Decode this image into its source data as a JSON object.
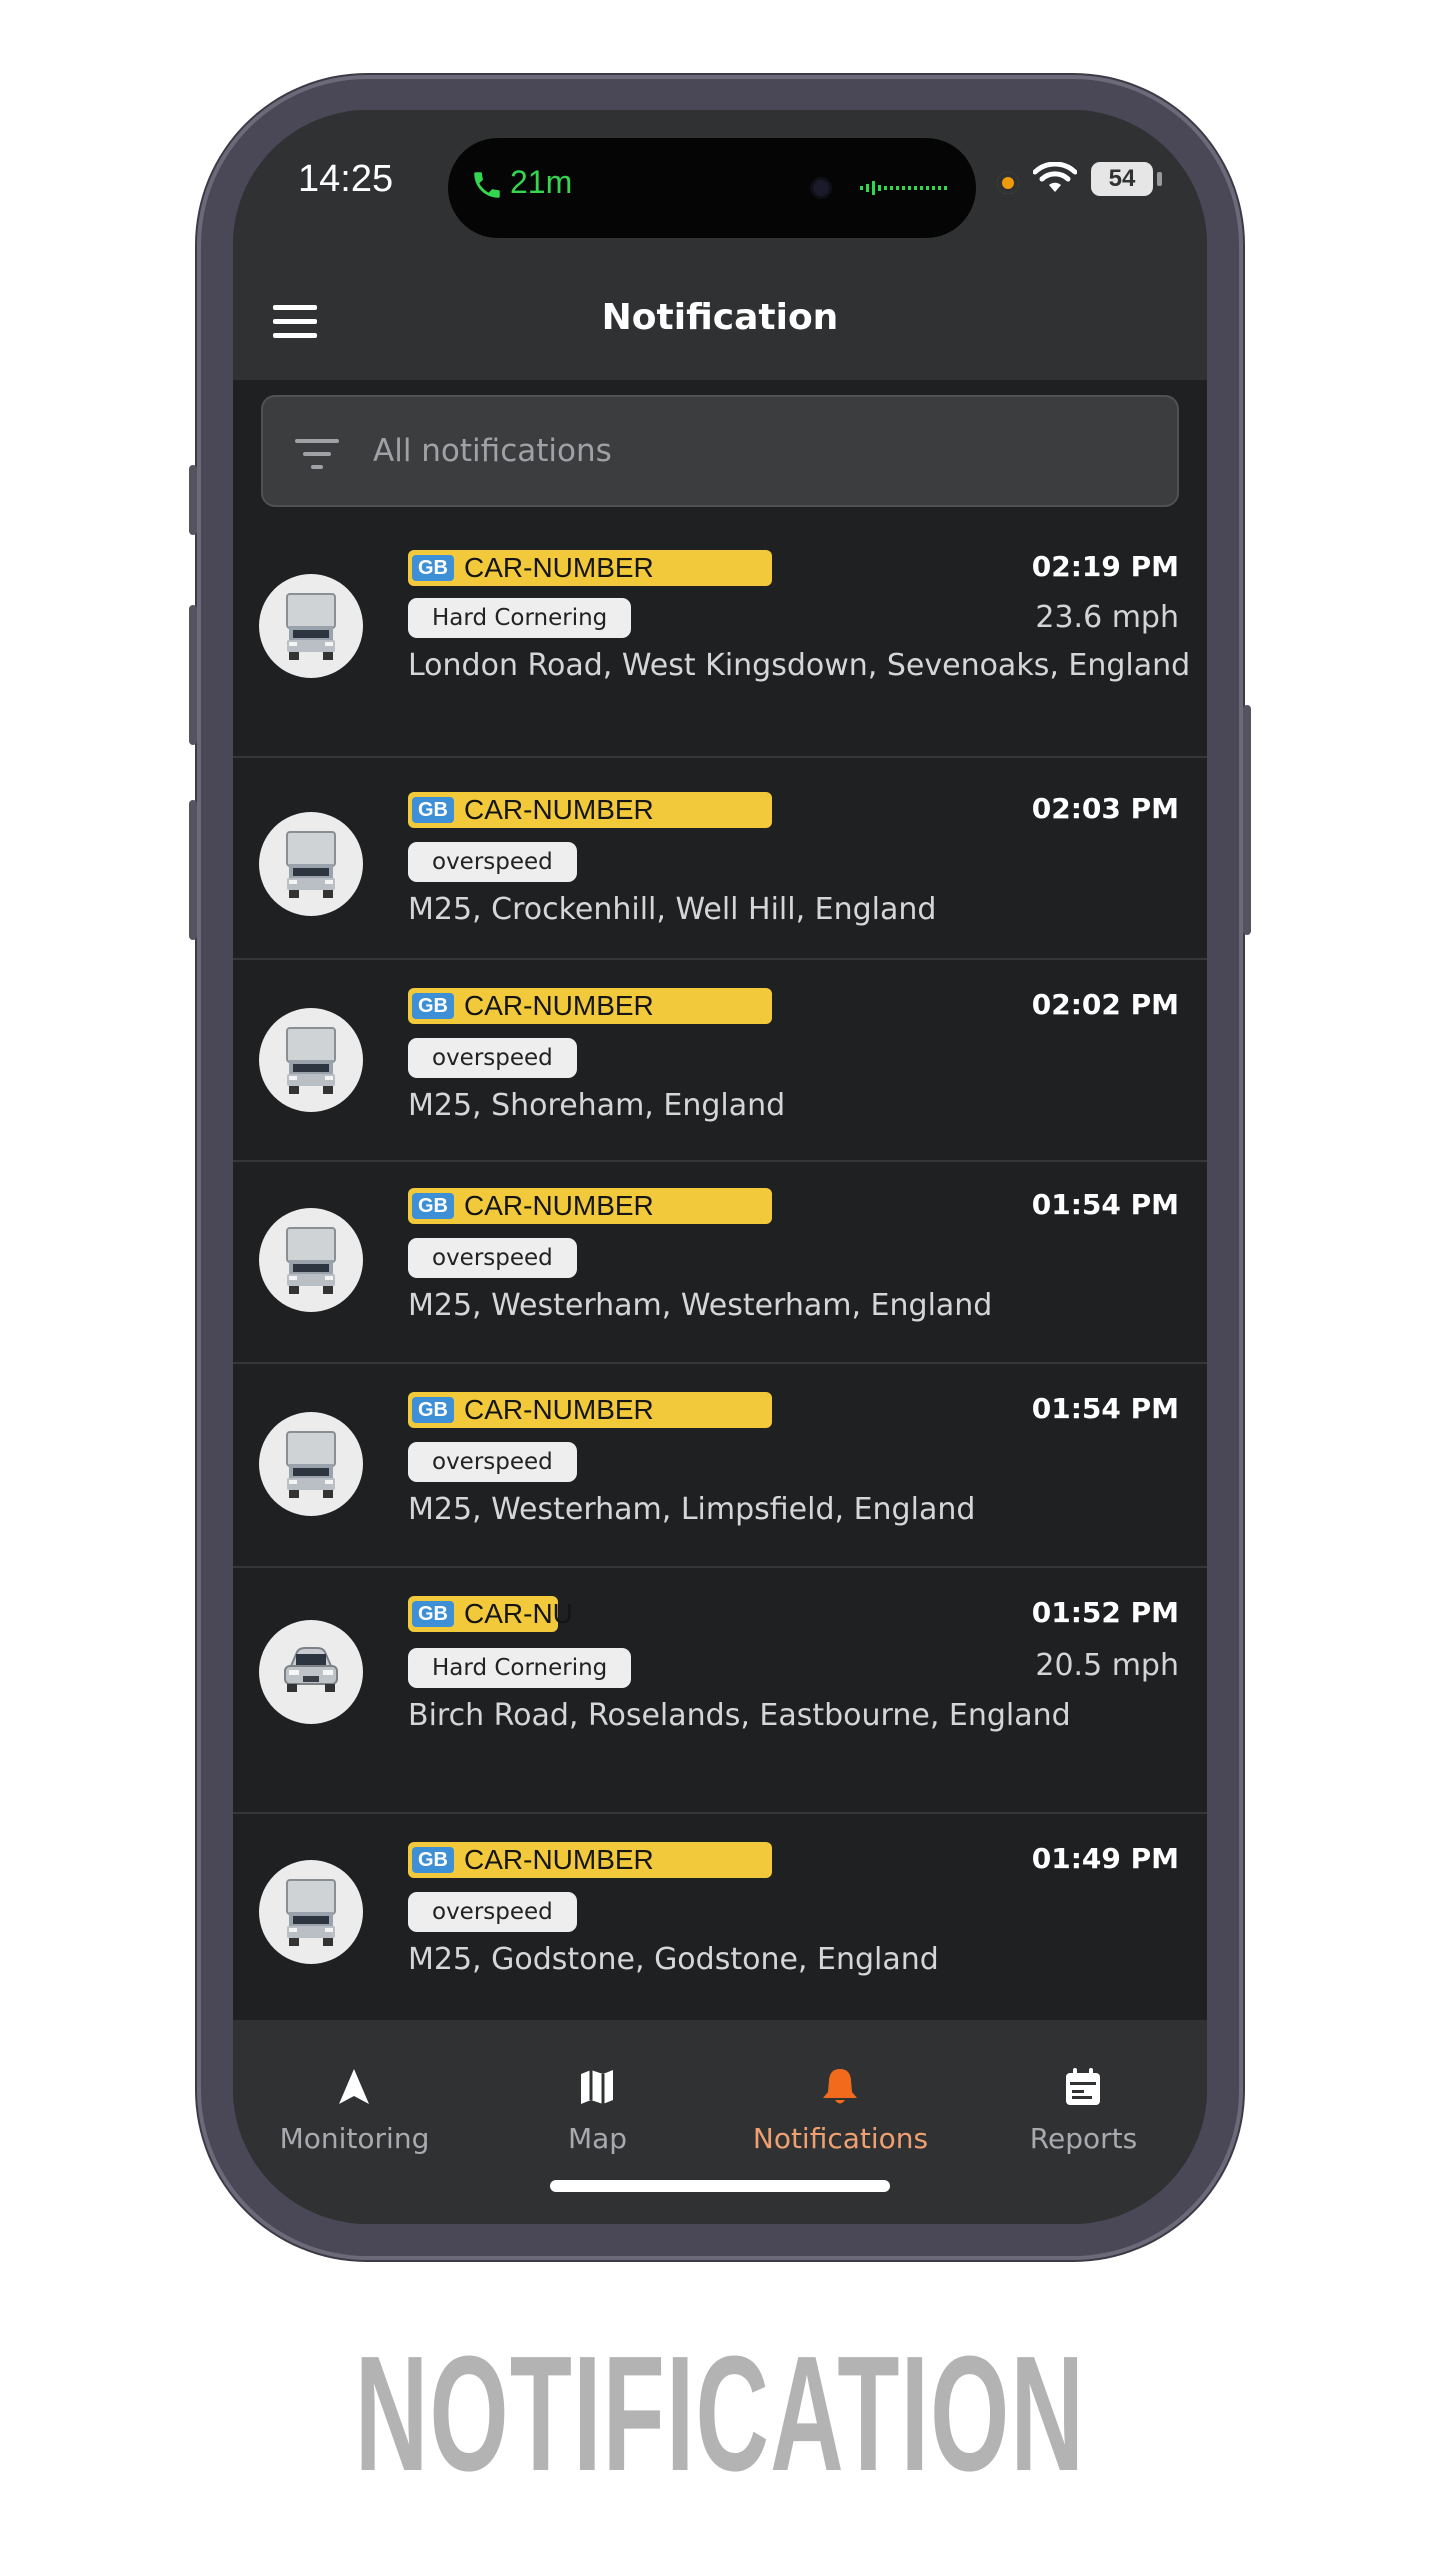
{
  "status_bar": {
    "time": "14:25",
    "call_duration": "21m",
    "battery": "54"
  },
  "header": {
    "title": "Notification"
  },
  "filter": {
    "label": "All notifications"
  },
  "colors": {
    "accent": "#f26a1b",
    "plate_yellow": "#f2c93a",
    "plate_blue": "#3d8fd6",
    "call_green": "#35d64f"
  },
  "notifications": [
    {
      "country": "GB",
      "plate": "CAR-NUMBER",
      "event": "Hard Cornering",
      "time": "02:19 PM",
      "speed": "23.6 mph",
      "address": "London Road, West Kingsdown, Sevenoaks, England",
      "vehicle_icon": "truck-icon"
    },
    {
      "country": "GB",
      "plate": "CAR-NUMBER",
      "event": "overspeed",
      "time": "02:03 PM",
      "speed": "",
      "address": "M25, Crockenhill, Well Hill, England",
      "vehicle_icon": "truck-icon"
    },
    {
      "country": "GB",
      "plate": "CAR-NUMBER",
      "event": "overspeed",
      "time": "02:02 PM",
      "speed": "",
      "address": "M25, Shoreham, England",
      "vehicle_icon": "truck-icon"
    },
    {
      "country": "GB",
      "plate": "CAR-NUMBER",
      "event": "overspeed",
      "time": "01:54 PM",
      "speed": "",
      "address": "M25, Westerham, Westerham, England",
      "vehicle_icon": "truck-icon"
    },
    {
      "country": "GB",
      "plate": "CAR-NUMBER",
      "event": "overspeed",
      "time": "01:54 PM",
      "speed": "",
      "address": "M25, Westerham, Limpsfield, England",
      "vehicle_icon": "truck-icon"
    },
    {
      "country": "GB",
      "plate": "CAR-NU",
      "event": "Hard Cornering",
      "time": "01:52 PM",
      "speed": "20.5 mph",
      "address": "Birch Road, Roselands, Eastbourne, England",
      "vehicle_icon": "car-icon"
    },
    {
      "country": "GB",
      "plate": "CAR-NUMBER",
      "event": "overspeed",
      "time": "01:49 PM",
      "speed": "",
      "address": "M25, Godstone, Godstone, England",
      "vehicle_icon": "truck-icon"
    }
  ],
  "bottom_nav": {
    "active": "Notifications",
    "items": [
      {
        "label": "Monitoring",
        "icon": "navigation-arrow-icon"
      },
      {
        "label": "Map",
        "icon": "map-icon"
      },
      {
        "label": "Notifications",
        "icon": "bell-icon"
      },
      {
        "label": "Reports",
        "icon": "calendar-icon"
      }
    ]
  },
  "caption": "NOTIFICATION"
}
